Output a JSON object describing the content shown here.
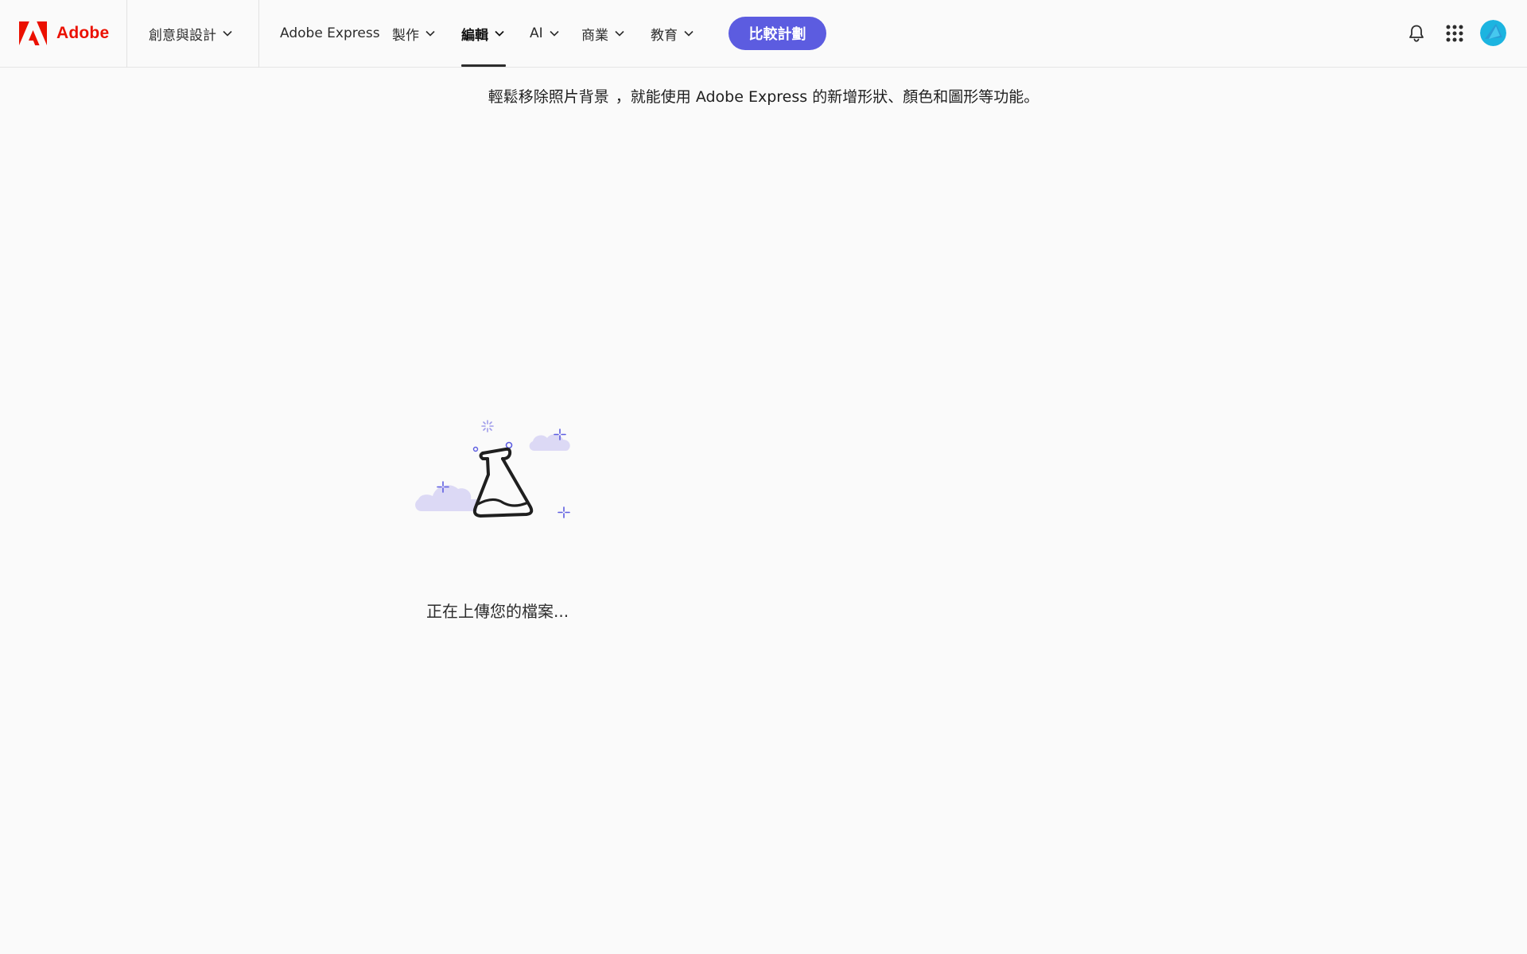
{
  "header": {
    "brand": {
      "name": "Adobe",
      "logo_color": "#eb1000",
      "icon": "adobe-logo-icon"
    },
    "menu": [
      {
        "label": "創意與設計",
        "has_dropdown": true,
        "active": false
      },
      {
        "label": "Adobe Express",
        "has_dropdown": false,
        "active": false
      },
      {
        "label": "製作",
        "has_dropdown": true,
        "active": false
      },
      {
        "label": "編輯",
        "has_dropdown": true,
        "active": true
      },
      {
        "label": "AI",
        "has_dropdown": true,
        "active": false
      },
      {
        "label": "商業",
        "has_dropdown": true,
        "active": false
      },
      {
        "label": "教育",
        "has_dropdown": true,
        "active": false
      }
    ],
    "cta": {
      "label": "比較計劃",
      "color": "#5c5ce0"
    },
    "utility_icons": [
      "bell-icon",
      "app-grid-icon",
      "avatar"
    ]
  },
  "banner": {
    "part1": "輕鬆移除照片背景",
    "part2": "，就能使用 Adobe Express 的新增形狀、顏色和圖形等功能。"
  },
  "upload": {
    "status": "正在上傳您的檔案...",
    "illustration": "flask-with-clouds-icon",
    "accent_color": "#5c5ce0",
    "cloud_color": "#dcd9f5"
  }
}
